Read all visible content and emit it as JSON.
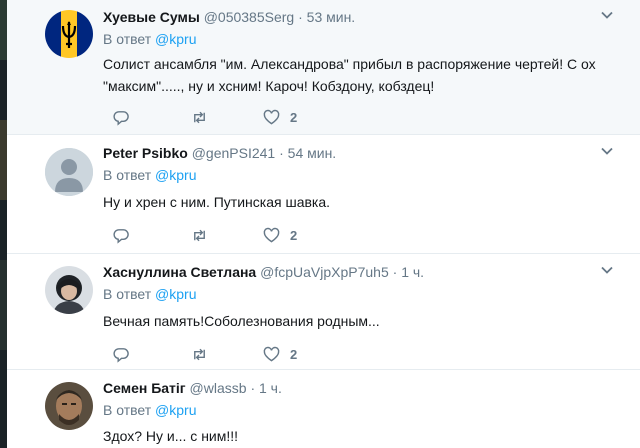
{
  "colors": {
    "accent": "#1da1f2",
    "muted": "#657786",
    "text": "#14171a",
    "highlight_bg": "#f5f8fa",
    "divider": "#e6ecf0"
  },
  "tweets": [
    {
      "name": "Хуевые Сумы",
      "handle": "@050385Serg",
      "separator": "·",
      "time": "53 мин.",
      "reply_prefix": "В ответ",
      "reply_handle": "@kpru",
      "text_lines": [
        "Солист ансамбля \"им. Александрова\" прибыл в распоряжение чертей! С ох",
        "\"максим\"....., ну и хсним! Кароч! Кобздону, кобздец!"
      ],
      "like_count": "2",
      "avatar": "barbados-flag-avatar"
    },
    {
      "name": "Peter Psibko",
      "handle": "@genPSI241",
      "separator": "·",
      "time": "54 мин.",
      "reply_prefix": "В ответ",
      "reply_handle": "@kpru",
      "text_lines": [
        "Ну и хрен с ним. Путинская шавка."
      ],
      "like_count": "2",
      "avatar": "default-avatar"
    },
    {
      "name": "Хаснуллина Светлана",
      "handle": "@fcpUaVjpXpP7uh5",
      "separator": "·",
      "time": "1 ч.",
      "reply_prefix": "В ответ",
      "reply_handle": "@kpru",
      "text_lines": [
        "Вечная память!Соболезнования родным..."
      ],
      "like_count": "2",
      "avatar": "photo-avatar"
    },
    {
      "name": "Семен Батіг",
      "handle": "@wlassb",
      "separator": "·",
      "time": "1 ч.",
      "reply_prefix": "В ответ",
      "reply_handle": "@kpru",
      "text_lines": [
        "Здох?  Ну и...  с ним!!!"
      ],
      "like_count": "",
      "avatar": "photo-avatar"
    }
  ]
}
